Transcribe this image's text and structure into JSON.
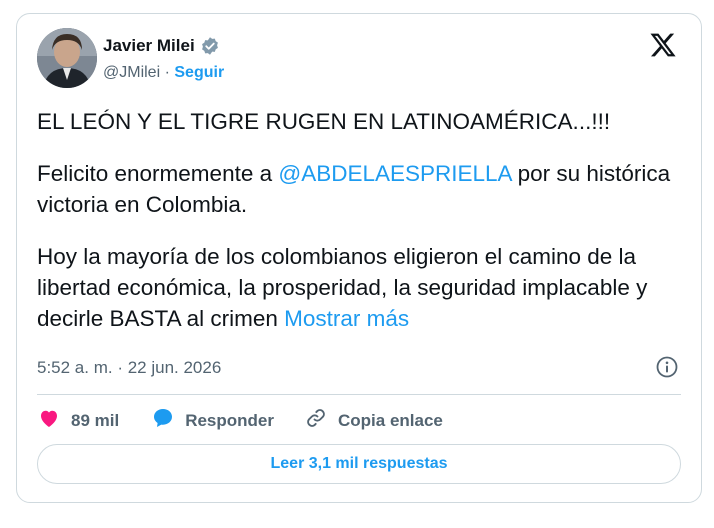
{
  "author": {
    "name": "Javier Milei",
    "handle": "@JMilei",
    "separator": "·",
    "follow_label": "Seguir"
  },
  "tweet": {
    "line1": "EL LEÓN Y EL TIGRE RUGEN EN LATINOAMÉRICA...!!!",
    "p2_before": "Felicito enormemente a ",
    "mention": "@ABDELAESPRIELLA",
    "p2_after": " por su histórica victoria en Colombia.",
    "p3": "Hoy la mayoría de los colombianos eligieron el camino de la libertad económica, la prosperidad, la seguridad implacable y decirle BASTA al crimen ",
    "show_more": "Mostrar más"
  },
  "meta": {
    "timestamp": "5:52 a. m. · 22 jun. 2026"
  },
  "actions": {
    "likes": "89 mil",
    "reply_label": "Responder",
    "copy_label": "Copia enlace"
  },
  "replies_button": "Leer 3,1 mil respuestas",
  "colors": {
    "accent": "#1d9bf0",
    "like": "#f91880",
    "text": "#0f1419",
    "secondary": "#536471",
    "border": "#cfd9de"
  },
  "icons": [
    "verified-badge-icon",
    "x-logo-icon",
    "info-icon",
    "heart-icon",
    "reply-bubble-icon",
    "link-icon"
  ]
}
